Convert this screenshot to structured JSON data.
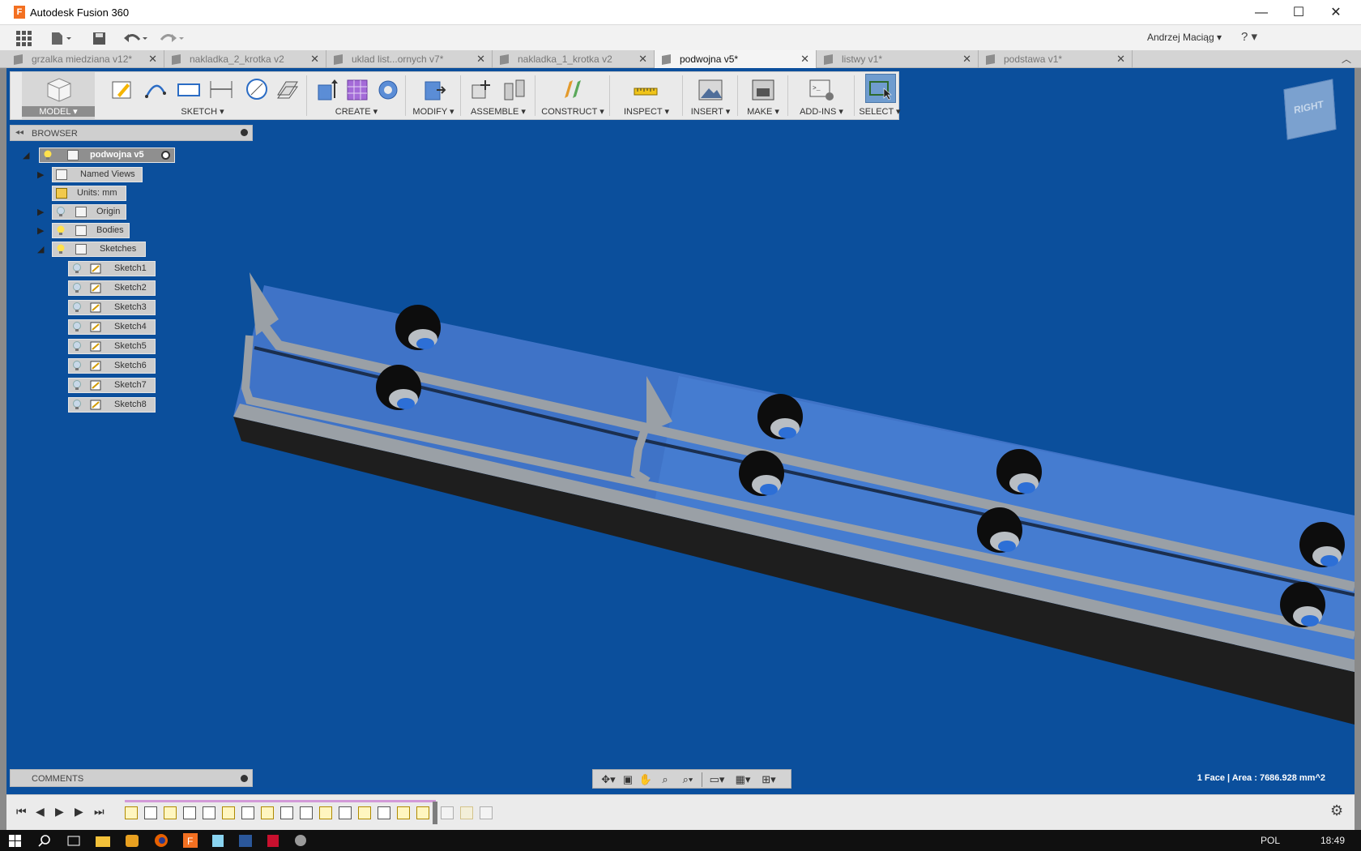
{
  "window": {
    "title": "Autodesk Fusion 360",
    "controls": {
      "minimize": "—",
      "maximize": "☐",
      "close": "✕"
    }
  },
  "quick_access": {
    "user": "Andrzej Maciąg ▾",
    "help": "? ▾",
    "icons": [
      "apps-grid-icon",
      "file-icon",
      "save-icon",
      "undo-icon",
      "redo-icon"
    ]
  },
  "tabs": [
    {
      "label": "grzalka miedziana v12*",
      "active": false
    },
    {
      "label": "nakladka_2_krotka v2",
      "active": false
    },
    {
      "label": "uklad list...ornych v7*",
      "active": false
    },
    {
      "label": "nakladka_1_krotka v2",
      "active": false
    },
    {
      "label": "podwojna v5*",
      "active": true
    },
    {
      "label": "listwy v1*",
      "active": false
    },
    {
      "label": "podstawa v1*",
      "active": false
    }
  ],
  "toolbar": {
    "model": "MODEL ▾",
    "sketch": "SKETCH ▾",
    "create": "CREATE ▾",
    "modify": "MODIFY ▾",
    "assemble": "ASSEMBLE ▾",
    "construct": "CONSTRUCT ▾",
    "inspect": "INSPECT ▾",
    "insert": "INSERT ▾",
    "make": "MAKE ▾",
    "addins": "ADD-INS ▾",
    "select": "SELECT ▾"
  },
  "browser": {
    "header": "BROWSER",
    "root": "podwojna v5",
    "named_views": "Named Views",
    "units": "Units: mm",
    "origin": "Origin",
    "bodies": "Bodies",
    "sketches": "Sketches",
    "sketch_items": [
      "Sketch1",
      "Sketch2",
      "Sketch3",
      "Sketch4",
      "Sketch5",
      "Sketch6",
      "Sketch7",
      "Sketch8"
    ]
  },
  "comments": {
    "label": "COMMENTS"
  },
  "status": {
    "text": "1 Face | Area : 7686.928 mm^2"
  },
  "viewcube": {
    "face": "RIGHT"
  },
  "colors": {
    "viewport": "#0b4f9c",
    "body_face": "#3f73c7",
    "rail": "#9aa0a6",
    "shadow": "#1e1e1e",
    "accent": "#f37021"
  },
  "taskbar": {
    "lang": "POL",
    "time": "18:49"
  }
}
